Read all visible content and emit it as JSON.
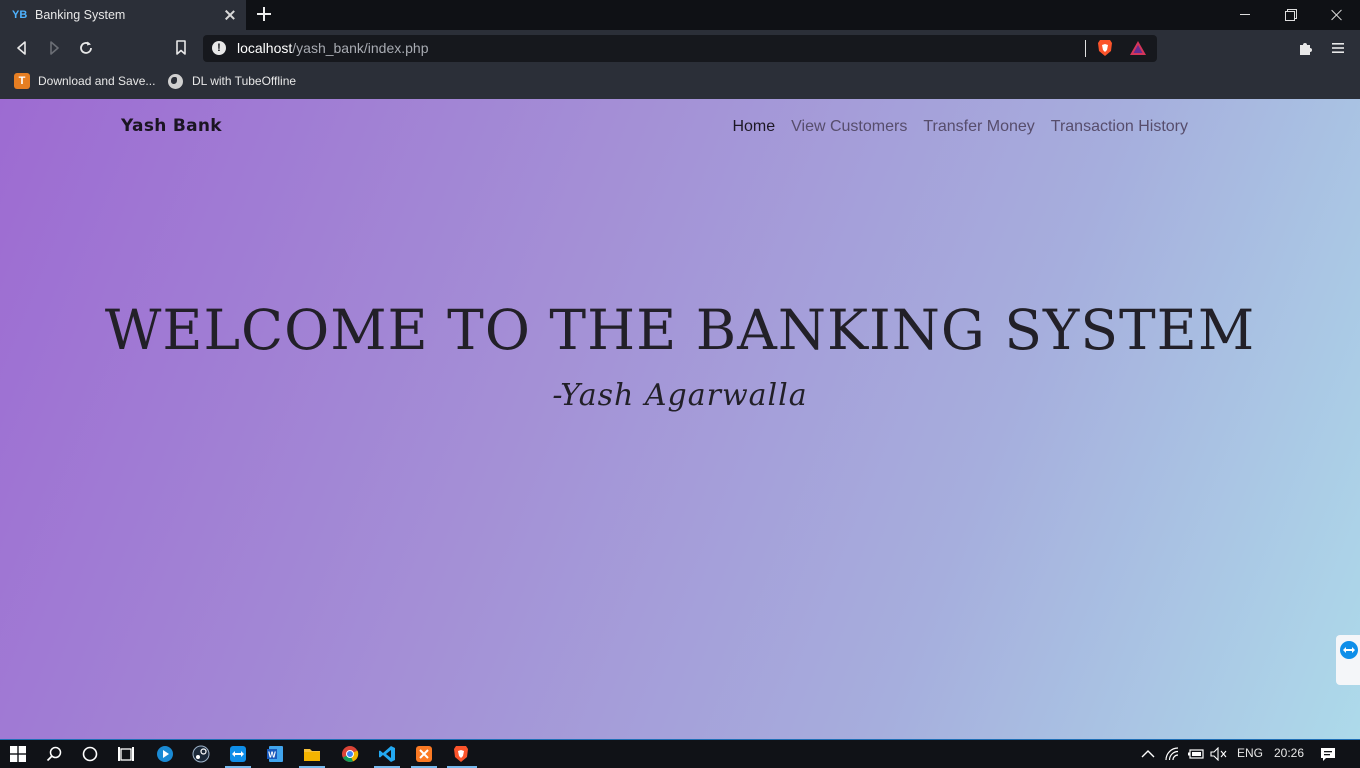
{
  "browser": {
    "tab_title": "Banking System",
    "favicon_text": "YB",
    "url_host": "localhost",
    "url_path": "/yash_bank/index.php",
    "bookmarks": [
      {
        "label": "Download and Save...",
        "icon": "tubeoffline-icon",
        "icon_text": "T"
      },
      {
        "label": "DL with TubeOffline",
        "icon": "globe-icon"
      }
    ]
  },
  "page": {
    "brand": "Yash Bank",
    "nav": [
      {
        "label": "Home",
        "active": true
      },
      {
        "label": "View Customers",
        "active": false
      },
      {
        "label": "Transfer Money",
        "active": false
      },
      {
        "label": "Transaction History",
        "active": false
      }
    ],
    "hero_title": "WELCOME TO THE BANKING SYSTEM",
    "hero_subtitle": "-Yash Agarwalla",
    "gradient_colors": [
      "#9d6bd2",
      "#a490d6",
      "#a6aedd",
      "#addaea"
    ]
  },
  "taskbar": {
    "apps": [
      "start-icon",
      "search-icon",
      "cortana-icon",
      "task-view-icon",
      "media-player-icon",
      "steam-icon",
      "teamviewer-icon",
      "word-icon",
      "file-explorer-icon",
      "chrome-icon",
      "vscode-icon",
      "xampp-icon",
      "brave-icon"
    ],
    "language": "ENG",
    "time": "20:26"
  }
}
